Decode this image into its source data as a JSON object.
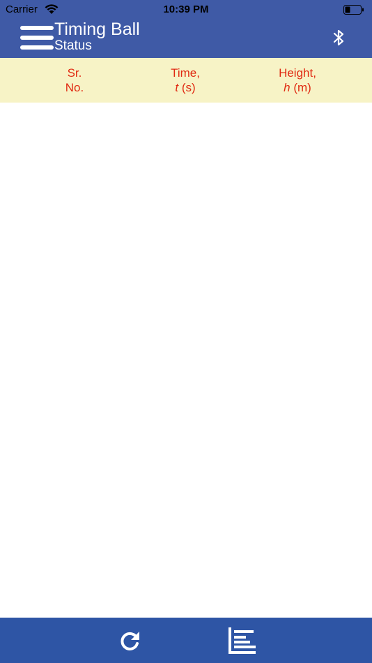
{
  "status_bar": {
    "carrier": "Carrier",
    "time": "10:39 PM",
    "icons": [
      "wifi-icon",
      "battery-icon"
    ]
  },
  "header": {
    "title": "Timing Ball",
    "subtitle": "Status",
    "menu_icon": "hamburger-menu-icon",
    "bluetooth_icon": "bluetooth-icon",
    "background_color": "#3f5aa6"
  },
  "table": {
    "header_background": "#f7f3c6",
    "header_text_color": "#e02a12",
    "columns": [
      {
        "line1": "Sr.",
        "line2": "No."
      },
      {
        "line1": "Time,",
        "var": "t",
        "unit": " (s)"
      },
      {
        "line1": "Height,",
        "var": "h",
        "unit": " (m)"
      }
    ],
    "rows": []
  },
  "bottom_bar": {
    "background_color": "#2e55a5",
    "buttons": [
      {
        "icon": "refresh-icon"
      },
      {
        "icon": "list-chart-icon"
      }
    ]
  }
}
